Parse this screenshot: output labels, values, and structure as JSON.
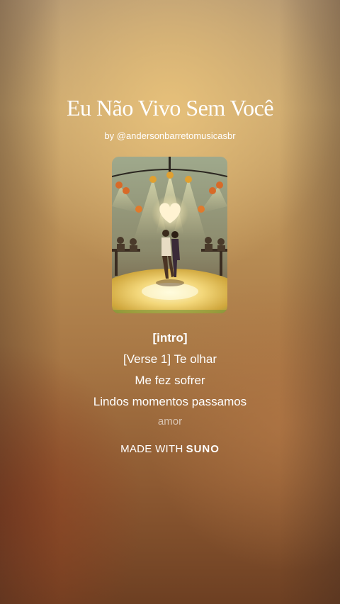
{
  "song": {
    "title": "Eu Não Vivo Sem Você",
    "byline": "by @andersonbarretomusicasbr"
  },
  "lyrics": {
    "lines": [
      "[intro]",
      "[Verse 1] Te olhar",
      "Me fez sofrer",
      "Lindos momentos passamos",
      "amor"
    ]
  },
  "footer": {
    "made_with": "MADE WITH",
    "brand": "SUNO"
  },
  "cover_art": {
    "icon": "dancing-couple-artwork"
  }
}
